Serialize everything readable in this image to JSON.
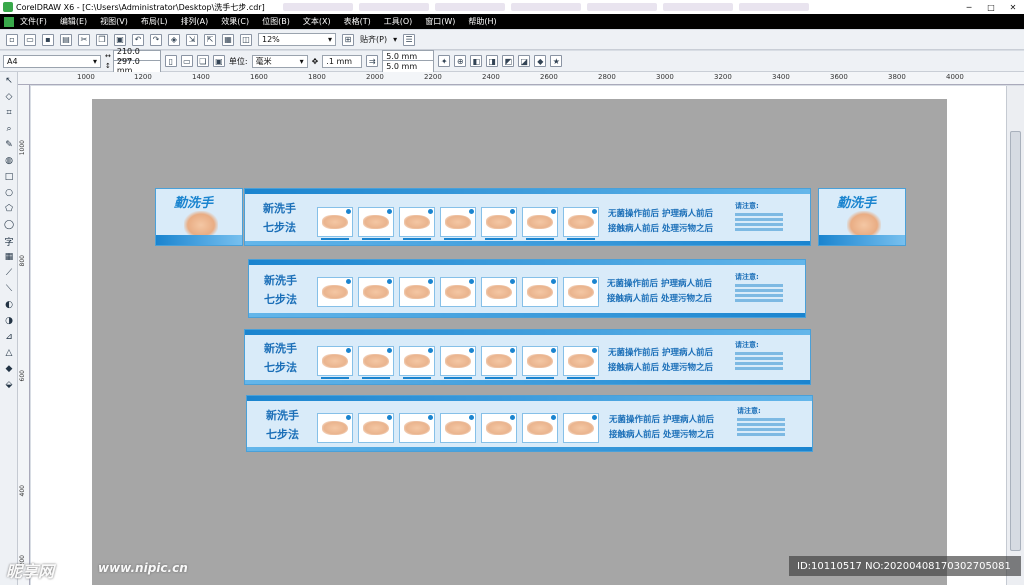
{
  "window": {
    "title": "CorelDRAW X6 - [C:\\Users\\Administrator\\Desktop\\洗手七步.cdr]"
  },
  "menu": [
    "文件(F)",
    "编辑(E)",
    "视图(V)",
    "布局(L)",
    "排列(A)",
    "效果(C)",
    "位图(B)",
    "文本(X)",
    "表格(T)",
    "工具(O)",
    "窗口(W)",
    "帮助(H)"
  ],
  "toolbar": {
    "zoom": "12%",
    "snap": "贴齐(P)"
  },
  "property_bar": {
    "page_size": "A4",
    "width": "210.0 mm",
    "height": "297.0 mm",
    "units_label": "单位:",
    "units": "毫米",
    "nudge": ".1 mm",
    "dup_x": "5.0 mm",
    "dup_y": "5.0 mm"
  },
  "ruler_h": [
    "1000",
    "1200",
    "1400",
    "1600",
    "1800",
    "2000",
    "2200",
    "2400",
    "2600",
    "2800",
    "3000",
    "3200",
    "3400",
    "3600",
    "3800",
    "4000"
  ],
  "ruler_v": [
    "1000",
    "800",
    "600",
    "400",
    "200"
  ],
  "toolbox": {
    "text_tool": "字"
  },
  "design": {
    "card_title": "勤洗手",
    "title_line1": "新洗手",
    "title_line2": "七步法",
    "moment1": "无菌操作前后 护理病人前后",
    "moment2": "接触病人前后 处理污物之后",
    "notes_title": "请注意:"
  },
  "watermark": {
    "logo": "昵享网",
    "url": "www.nipic.cn",
    "id": "ID:10110517 NO:20200408170302705081"
  },
  "colors": {
    "accent": "#1a84cf",
    "panel": "#d9ebf9",
    "page": "#a6a6a6"
  }
}
